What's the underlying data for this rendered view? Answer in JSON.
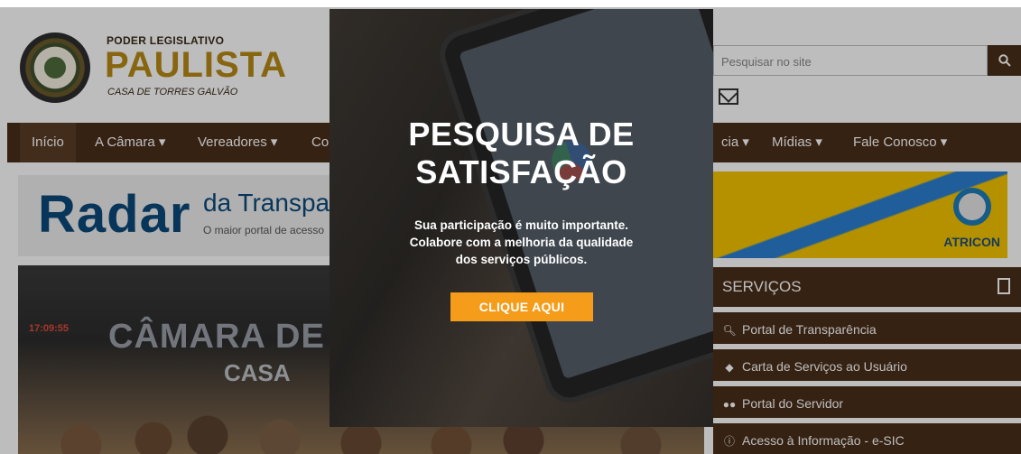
{
  "header": {
    "logo_small": "PODER LEGISLATIVO",
    "logo_big": "PAULISTA",
    "logo_sub": "CASA DE TORRES GALVÃO",
    "search_placeholder": "Pesquisar no site"
  },
  "nav": {
    "items": [
      "Início",
      "A Câmara ▾",
      "Vereadores ▾",
      "Co",
      "cia ▾",
      "Mídias ▾",
      "Fale Conosco ▾"
    ]
  },
  "banners": {
    "radar_word": "Radar",
    "radar_sub": "da Transpar",
    "radar_tag": "O maior portal de acesso",
    "atricon_label": "ATRICON"
  },
  "hero": {
    "clock": "17:09:55",
    "word1": "CÂMARA DE VER",
    "word2": "CASA"
  },
  "services": {
    "title": "SERVIÇOS",
    "items": [
      {
        "label": "Portal de Transparência",
        "icon": "search-icon"
      },
      {
        "label": "Carta de Serviços ao Usuário",
        "icon": "tag-icon"
      },
      {
        "label": "Portal do Servidor",
        "icon": "users-icon"
      },
      {
        "label": "Acesso à Informação - e-SIC",
        "icon": "info-icon"
      }
    ]
  },
  "modal": {
    "title_line1": "PESQUISA DE",
    "title_line2": "SATISFAÇÃO",
    "text_line1": "Sua participação é muito importante.",
    "text_line2": "Colabore com a melhoria da qualidade",
    "text_line3": "dos serviços públicos.",
    "button": "CLIQUE AQUI"
  },
  "colors": {
    "brand_brown": "#4a2f1a",
    "logo_gold": "#b88a16",
    "cta_orange": "#f59c1a"
  }
}
